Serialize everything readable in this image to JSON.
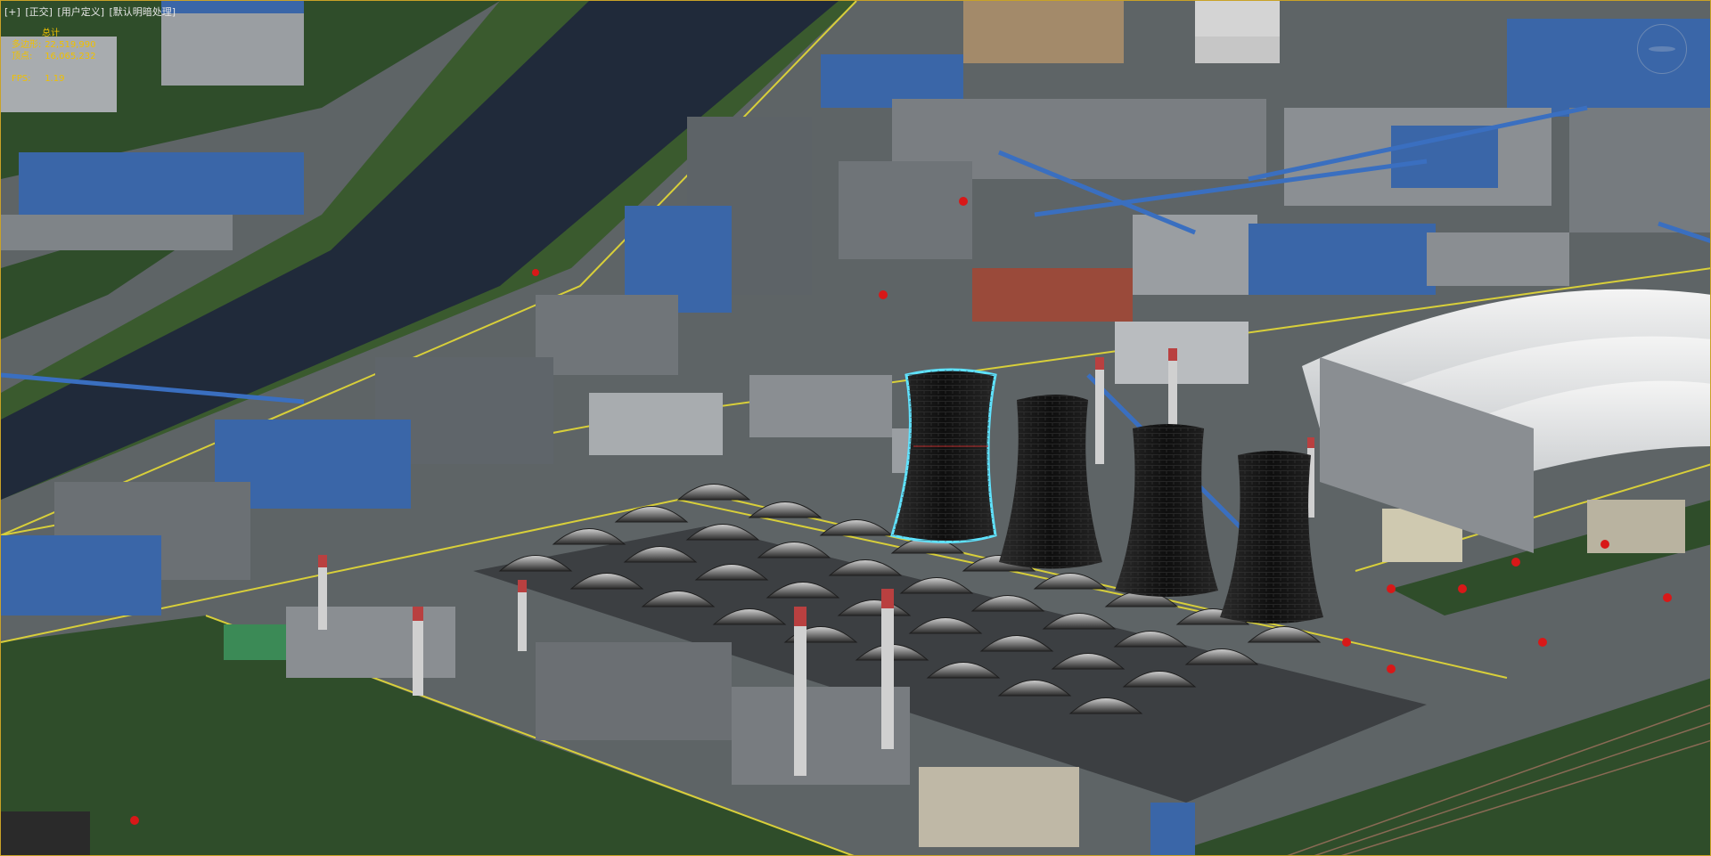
{
  "viewport": {
    "label_parts": [
      "[+]",
      "[正交]",
      "[用户定义]",
      "[默认明暗处理]"
    ]
  },
  "stats": {
    "section_title": "总计",
    "rows": [
      {
        "key": "多边形:",
        "value": "22,519,990"
      },
      {
        "key": "顶点:",
        "value": "16,065,232"
      }
    ],
    "fps_label": "FPS:",
    "fps_value": "1.19"
  },
  "scene": {
    "objects": [
      {
        "name": "cooling-tower",
        "count": 4,
        "selected_index": 0
      },
      {
        "name": "chimney-stack",
        "count": 6
      },
      {
        "name": "coal-storage-dome",
        "count": 4
      },
      {
        "name": "arched-workshop-hall",
        "count": 36
      },
      {
        "name": "river"
      },
      {
        "name": "industrial-complex"
      }
    ],
    "colors": {
      "ground_gray": "#5e6466",
      "grass_green": "#2f4d2a",
      "river": "#202a3a",
      "roof_blue": "#3a66a8",
      "wall_gray": "#9a9ea2",
      "tower_black": "#1a1a1a",
      "selection_cyan": "#5fe3ff",
      "road_yellow": "#d8cf3a"
    }
  }
}
